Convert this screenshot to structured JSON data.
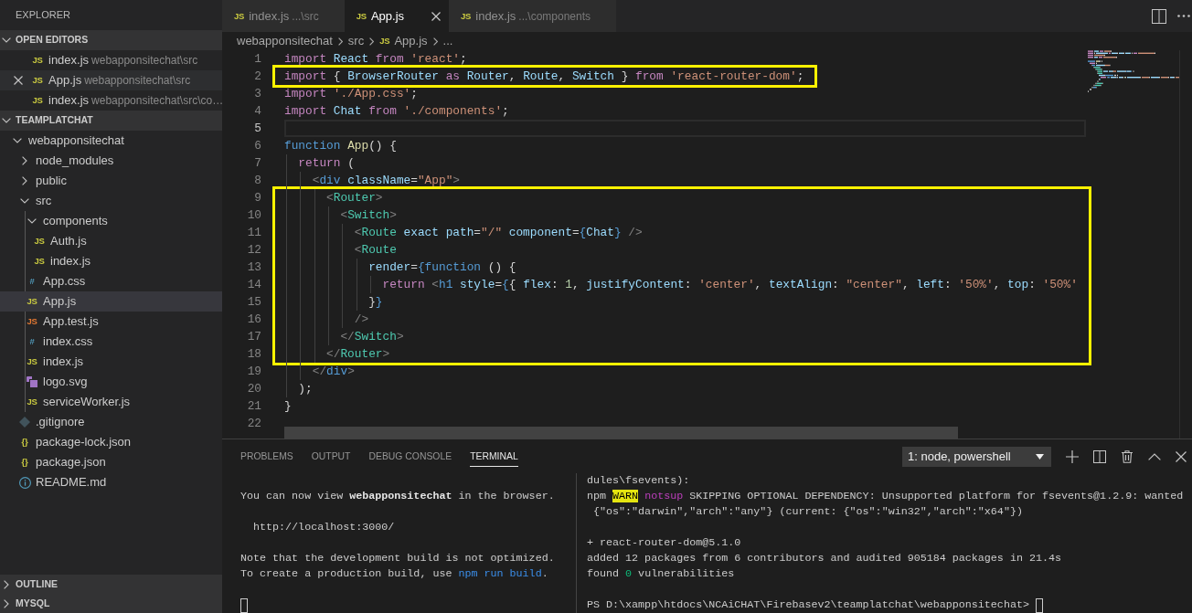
{
  "explorer": {
    "title": "EXPLORER",
    "open_editors": {
      "title": "OPEN EDITORS",
      "expanded": true,
      "items": [
        {
          "kind": "js",
          "icon": "JS",
          "name": "index.js",
          "description": "webapponsitechat\\src",
          "selected": false
        },
        {
          "kind": "js",
          "icon": "JS",
          "name": "App.js",
          "description": "webapponsitechat\\src",
          "selected": true
        },
        {
          "kind": "js",
          "icon": "JS",
          "name": "index.js",
          "description": "webapponsitechat\\src\\co…",
          "selected": false
        }
      ]
    },
    "workspace": {
      "title": "TEAMPLATCHAT",
      "expanded": true,
      "tree": [
        {
          "kind": "folder",
          "name": "webapponsitechat",
          "expanded": true,
          "selected": false,
          "children": [
            {
              "kind": "folder",
              "name": "node_modules",
              "expanded": false,
              "selected": false
            },
            {
              "kind": "folder",
              "name": "public",
              "expanded": false,
              "selected": false
            },
            {
              "kind": "folder",
              "name": "src",
              "expanded": true,
              "selected": false,
              "children": [
                {
                  "kind": "folder",
                  "name": "components",
                  "expanded": true,
                  "selected": false,
                  "children": [
                    {
                      "kind": "js",
                      "icon": "JS",
                      "name": "Auth.js",
                      "selected": false
                    },
                    {
                      "kind": "js",
                      "icon": "JS",
                      "name": "index.js",
                      "selected": false
                    }
                  ]
                },
                {
                  "kind": "css",
                  "icon": "#",
                  "name": "App.css",
                  "selected": false
                },
                {
                  "kind": "js",
                  "icon": "JS",
                  "name": "App.js",
                  "selected": true
                },
                {
                  "kind": "test",
                  "icon": "JS",
                  "name": "App.test.js",
                  "selected": false
                },
                {
                  "kind": "css",
                  "icon": "#",
                  "name": "index.css",
                  "selected": false
                },
                {
                  "kind": "js",
                  "icon": "JS",
                  "name": "index.js",
                  "selected": false
                },
                {
                  "kind": "svg",
                  "name": "logo.svg",
                  "selected": false
                },
                {
                  "kind": "js",
                  "icon": "JS",
                  "name": "serviceWorker.js",
                  "selected": false
                }
              ]
            },
            {
              "kind": "git",
              "name": ".gitignore",
              "selected": false
            },
            {
              "kind": "json",
              "icon": "{}",
              "name": "package-lock.json",
              "selected": false
            },
            {
              "kind": "json",
              "icon": "{}",
              "name": "package.json",
              "selected": false
            },
            {
              "kind": "info",
              "name": "README.md",
              "selected": false
            }
          ]
        }
      ]
    },
    "collapsed_sections": [
      {
        "title": "OUTLINE",
        "expanded": false
      },
      {
        "title": "MYSQL",
        "expanded": false
      }
    ]
  },
  "editor": {
    "tabs": [
      {
        "kind": "js",
        "icon": "JS",
        "name": "index.js",
        "description": "...\\src",
        "selected": false
      },
      {
        "kind": "js",
        "icon": "JS",
        "name": "App.js",
        "selected": true
      },
      {
        "kind": "js",
        "icon": "JS",
        "name": "index.js",
        "description": "...\\components",
        "selected": false
      }
    ],
    "breadcrumbs": [
      {
        "kind": "folder",
        "text": "webapponsitechat"
      },
      {
        "kind": "folder",
        "text": "src"
      },
      {
        "kind": "js",
        "icon": "JS",
        "text": "App.js"
      },
      {
        "kind": "more",
        "text": "..."
      }
    ],
    "blocks": [
      {
        "boxed": false,
        "lines": [
          {
            "number": "1",
            "current": false,
            "tokens": [
              {
                "text": "import ",
                "kind": "keyword"
              },
              {
                "text": "React ",
                "kind": "variable"
              },
              {
                "text": "from ",
                "kind": "keyword"
              },
              {
                "text": "'react'",
                "kind": "string"
              },
              {
                "text": ";",
                "kind": "plain"
              }
            ]
          }
        ]
      },
      {
        "boxed": true,
        "lines": [
          {
            "number": "2",
            "current": false,
            "tokens": [
              {
                "text": "import ",
                "kind": "keyword"
              },
              {
                "text": "{ ",
                "kind": "plain"
              },
              {
                "text": "BrowserRouter ",
                "kind": "variable"
              },
              {
                "text": "as ",
                "kind": "keyword"
              },
              {
                "text": "Router",
                "kind": "variable"
              },
              {
                "text": ", ",
                "kind": "plain"
              },
              {
                "text": "Route",
                "kind": "variable"
              },
              {
                "text": ", ",
                "kind": "plain"
              },
              {
                "text": "Switch ",
                "kind": "variable"
              },
              {
                "text": "} ",
                "kind": "plain"
              },
              {
                "text": "from ",
                "kind": "keyword"
              },
              {
                "text": "'react-router-dom'",
                "kind": "string"
              },
              {
                "text": ";",
                "kind": "plain"
              }
            ]
          }
        ]
      },
      {
        "boxed": false,
        "lines": [
          {
            "number": "3",
            "current": false,
            "tokens": [
              {
                "text": "import ",
                "kind": "keyword"
              },
              {
                "text": "'./App.css'",
                "kind": "string"
              },
              {
                "text": ";",
                "kind": "plain"
              }
            ]
          },
          {
            "number": "4",
            "current": false,
            "tokens": [
              {
                "text": "import ",
                "kind": "keyword"
              },
              {
                "text": "Chat ",
                "kind": "variable"
              },
              {
                "text": "from ",
                "kind": "keyword"
              },
              {
                "text": "'./components'",
                "kind": "string"
              },
              {
                "text": ";",
                "kind": "plain"
              }
            ]
          },
          {
            "number": "5",
            "current": true
          },
          {
            "number": "6",
            "current": false,
            "tokens": [
              {
                "text": "function ",
                "kind": "storage"
              },
              {
                "text": "App",
                "kind": "function"
              },
              {
                "text": "() {",
                "kind": "plain"
              }
            ]
          },
          {
            "number": "7",
            "current": false,
            "tokens": [
              {
                "text": "  return ",
                "kind": "keyword"
              },
              {
                "text": "(",
                "kind": "plain"
              }
            ]
          },
          {
            "number": "8",
            "current": false,
            "tokens": [
              {
                "text": "    <",
                "kind": "bracket"
              },
              {
                "text": "div ",
                "kind": "tag"
              },
              {
                "text": "className",
                "kind": "variable"
              },
              {
                "text": "=",
                "kind": "plain"
              },
              {
                "text": "\"App\"",
                "kind": "string"
              },
              {
                "text": ">",
                "kind": "bracket"
              }
            ]
          }
        ]
      },
      {
        "boxed": true,
        "lines": [
          {
            "number": "9",
            "current": false,
            "tokens": [
              {
                "text": "      <",
                "kind": "bracket"
              },
              {
                "text": "Router",
                "kind": "component"
              },
              {
                "text": ">",
                "kind": "bracket"
              }
            ]
          },
          {
            "number": "10",
            "current": false,
            "tokens": [
              {
                "text": "        <",
                "kind": "bracket"
              },
              {
                "text": "Switch",
                "kind": "component"
              },
              {
                "text": ">",
                "kind": "bracket"
              }
            ]
          },
          {
            "number": "11",
            "current": false,
            "tokens": [
              {
                "text": "          <",
                "kind": "bracket"
              },
              {
                "text": "Route ",
                "kind": "component"
              },
              {
                "text": "exact ",
                "kind": "variable"
              },
              {
                "text": "path",
                "kind": "variable"
              },
              {
                "text": "=",
                "kind": "plain"
              },
              {
                "text": "\"/\" ",
                "kind": "string"
              },
              {
                "text": "component",
                "kind": "variable"
              },
              {
                "text": "=",
                "kind": "plain"
              },
              {
                "text": "{",
                "kind": "brace"
              },
              {
                "text": "Chat",
                "kind": "variable"
              },
              {
                "text": "} ",
                "kind": "brace"
              },
              {
                "text": "/>",
                "kind": "bracket"
              }
            ]
          },
          {
            "number": "12",
            "current": false,
            "tokens": [
              {
                "text": "          <",
                "kind": "bracket"
              },
              {
                "text": "Route",
                "kind": "component"
              }
            ]
          },
          {
            "number": "13",
            "current": false,
            "tokens": [
              {
                "text": "            render",
                "kind": "variable"
              },
              {
                "text": "=",
                "kind": "plain"
              },
              {
                "text": "{",
                "kind": "brace"
              },
              {
                "text": "function ",
                "kind": "storage"
              },
              {
                "text": "() {",
                "kind": "plain"
              }
            ]
          },
          {
            "number": "14",
            "current": false,
            "tokens": [
              {
                "text": "              return ",
                "kind": "keyword"
              },
              {
                "text": "<",
                "kind": "bracket"
              },
              {
                "text": "h1 ",
                "kind": "tag"
              },
              {
                "text": "style",
                "kind": "variable"
              },
              {
                "text": "=",
                "kind": "plain"
              },
              {
                "text": "{",
                "kind": "brace"
              },
              {
                "text": "{ ",
                "kind": "plain"
              },
              {
                "text": "flex",
                "kind": "variable"
              },
              {
                "text": ": ",
                "kind": "plain"
              },
              {
                "text": "1",
                "kind": "number"
              },
              {
                "text": ", ",
                "kind": "plain"
              },
              {
                "text": "justifyContent",
                "kind": "variable"
              },
              {
                "text": ": ",
                "kind": "plain"
              },
              {
                "text": "'center'",
                "kind": "string"
              },
              {
                "text": ", ",
                "kind": "plain"
              },
              {
                "text": "textAlign",
                "kind": "variable"
              },
              {
                "text": ": ",
                "kind": "plain"
              },
              {
                "text": "\"center\"",
                "kind": "string"
              },
              {
                "text": ", ",
                "kind": "plain"
              },
              {
                "text": "left",
                "kind": "variable"
              },
              {
                "text": ": ",
                "kind": "plain"
              },
              {
                "text": "'50%'",
                "kind": "string"
              },
              {
                "text": ", ",
                "kind": "plain"
              },
              {
                "text": "top",
                "kind": "variable"
              },
              {
                "text": ": ",
                "kind": "plain"
              },
              {
                "text": "'50%'",
                "kind": "string"
              }
            ]
          },
          {
            "number": "15",
            "current": false,
            "tokens": [
              {
                "text": "            }",
                "kind": "plain"
              },
              {
                "text": "}",
                "kind": "brace"
              }
            ]
          },
          {
            "number": "16",
            "current": false,
            "tokens": [
              {
                "text": "          />",
                "kind": "bracket"
              }
            ]
          },
          {
            "number": "17",
            "current": false,
            "tokens": [
              {
                "text": "        </",
                "kind": "bracket"
              },
              {
                "text": "Switch",
                "kind": "component"
              },
              {
                "text": ">",
                "kind": "bracket"
              }
            ]
          },
          {
            "number": "18",
            "current": false,
            "tokens": [
              {
                "text": "      </",
                "kind": "bracket"
              },
              {
                "text": "Router",
                "kind": "component"
              },
              {
                "text": ">",
                "kind": "bracket"
              }
            ]
          }
        ]
      },
      {
        "boxed": false,
        "lines": [
          {
            "number": "19",
            "current": false,
            "tokens": [
              {
                "text": "    </",
                "kind": "bracket"
              },
              {
                "text": "div",
                "kind": "tag"
              },
              {
                "text": ">",
                "kind": "bracket"
              }
            ]
          },
          {
            "number": "20",
            "current": false,
            "tokens": [
              {
                "text": "  );",
                "kind": "plain"
              }
            ]
          },
          {
            "number": "21",
            "current": false,
            "tokens": [
              {
                "text": "}",
                "kind": "plain"
              }
            ]
          },
          {
            "number": "22",
            "current": false
          }
        ]
      }
    ]
  },
  "panel": {
    "tabs": [
      {
        "label": "PROBLEMS",
        "selected": false
      },
      {
        "label": "OUTPUT",
        "selected": false
      },
      {
        "label": "DEBUG CONSOLE",
        "selected": false
      },
      {
        "label": "TERMINAL",
        "selected": true
      }
    ],
    "terminal_select": "1: node, powershell",
    "panes": [
      {
        "paragraphs": [
          [
            [
              {
                "text": "You can now view ",
                "kind": "plain"
              },
              {
                "text": "webapponsitechat",
                "kind": "bold"
              },
              {
                "text": " in the browser.",
                "kind": "plain"
              }
            ]
          ],
          [
            [
              {
                "text": "  http://localhost:3000/",
                "kind": "plain"
              }
            ]
          ],
          [
            [
              {
                "text": "Note that the development build is not optimized.",
                "kind": "plain"
              }
            ],
            [
              {
                "text": "To create a production build, use ",
                "kind": "plain"
              },
              {
                "text": "npm run build",
                "kind": "link"
              },
              {
                "text": ".",
                "kind": "plain"
              }
            ]
          ]
        ],
        "cursor": true
      },
      {
        "paragraphs": [
          [
            [
              {
                "text": "dules\\fsevents):",
                "kind": "plain"
              }
            ],
            [
              {
                "text": "npm ",
                "kind": "plain"
              },
              {
                "text": "WARN",
                "kind": "warn"
              },
              {
                "text": " notsup",
                "kind": "notice"
              },
              {
                "text": " SKIPPING OPTIONAL DEPENDENCY: Unsupported platform for fsevents@1.2.9: wanted",
                "kind": "plain"
              }
            ],
            [
              {
                "text": " {\"os\":\"darwin\",\"arch\":\"any\"} (current: {\"os\":\"win32\",\"arch\":\"x64\"})",
                "kind": "plain"
              }
            ]
          ],
          [
            [
              {
                "text": "+ react-router-dom@5.1.0",
                "kind": "plain"
              }
            ],
            [
              {
                "text": "added 12 packages from 6 contributors and audited 905184 packages in 21.4s",
                "kind": "plain"
              }
            ],
            [
              {
                "text": "found ",
                "kind": "plain"
              },
              {
                "text": "0",
                "kind": "good"
              },
              {
                "text": " vulnerabilities",
                "kind": "plain"
              }
            ]
          ]
        ],
        "prompt": "PS D:\\xampp\\htdocs\\NCAiCHAT\\Firebasev2\\teamplatchat\\webapponsitechat>",
        "cursor": true
      }
    ]
  }
}
